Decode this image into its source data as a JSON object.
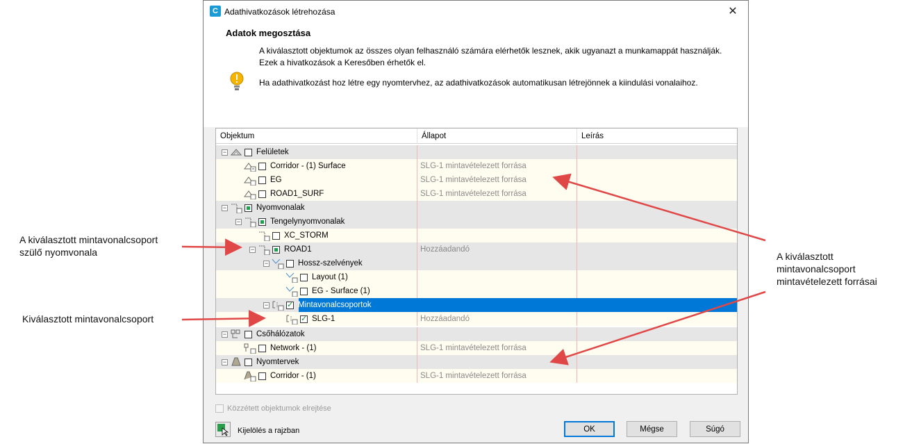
{
  "window": {
    "title": "Adathivatkozások létrehozása",
    "app_icon_letter": "C",
    "close_glyph": "✕"
  },
  "header": {
    "title": "Adatok megosztása",
    "info1": "A kiválasztott objektumok az összes olyan felhasználó számára elérhetők lesznek, akik ugyanazt a munkamappát használják. Ezek a hivatkozások a Keresőben érhetők el.",
    "info2": "Ha adathivatkozást hoz létre egy nyomtervhez, az adathivatkozások automatikusan létrejönnek a kiindulási vonalaihoz."
  },
  "grid": {
    "columns": [
      "Objektum",
      "Állapot",
      "Leírás"
    ],
    "rows": [
      {
        "label": "Felületek",
        "state": "",
        "group": true
      },
      {
        "label": "Corridor - (1) Surface",
        "state": "SLG-1 mintavételezett forrása",
        "group": false
      },
      {
        "label": "EG",
        "state": "SLG-1 mintavételezett forrása",
        "group": false
      },
      {
        "label": "ROAD1_SURF",
        "state": "SLG-1 mintavételezett forrása",
        "group": false
      },
      {
        "label": "Nyomvonalak",
        "state": "",
        "group": true
      },
      {
        "label": "Tengelynyomvonalak",
        "state": "",
        "group": true
      },
      {
        "label": "XC_STORM",
        "state": "",
        "group": false
      },
      {
        "label": "ROAD1",
        "state": "Hozzáadandó",
        "group": false
      },
      {
        "label": "Hossz-szelvények",
        "state": "",
        "group": true
      },
      {
        "label": "Layout (1)",
        "state": "",
        "group": false
      },
      {
        "label": "EG - Surface (1)",
        "state": "",
        "group": false
      },
      {
        "label": "Mintavonalcsoportok",
        "state": "",
        "group": true
      },
      {
        "label": "SLG-1",
        "state": "Hozzáadandó",
        "group": false
      },
      {
        "label": "Csőhálózatok",
        "state": "",
        "group": true
      },
      {
        "label": "Network - (1)",
        "state": "SLG-1 mintavételezett forrása",
        "group": false
      },
      {
        "label": "Nyomtervek",
        "state": "",
        "group": true
      },
      {
        "label": "Corridor - (1)",
        "state": "SLG-1 mintavételezett forrása",
        "group": false
      }
    ]
  },
  "footer": {
    "hide_published": "Közzétett objektumok elrejtése",
    "pick_label": "Kijelölés a rajzban",
    "ok": "OK",
    "cancel": "Mégse",
    "help": "Súgó"
  },
  "annotations": {
    "parent_alignment_l1": "A kiválasztott mintavonalcsoport",
    "parent_alignment_l2": "szülő nyomvonala",
    "selected_group": "Kiválasztott mintavonalcsoport",
    "sources_l1": "A kiválasztott",
    "sources_l2": "mintavonalcsoport",
    "sources_l3": "mintavételezett forrásai"
  },
  "colors": {
    "selection": "#0078d7",
    "row_bg": "#fffdf0",
    "group_bg": "#e6e6e6",
    "arrow": "#e04848"
  }
}
